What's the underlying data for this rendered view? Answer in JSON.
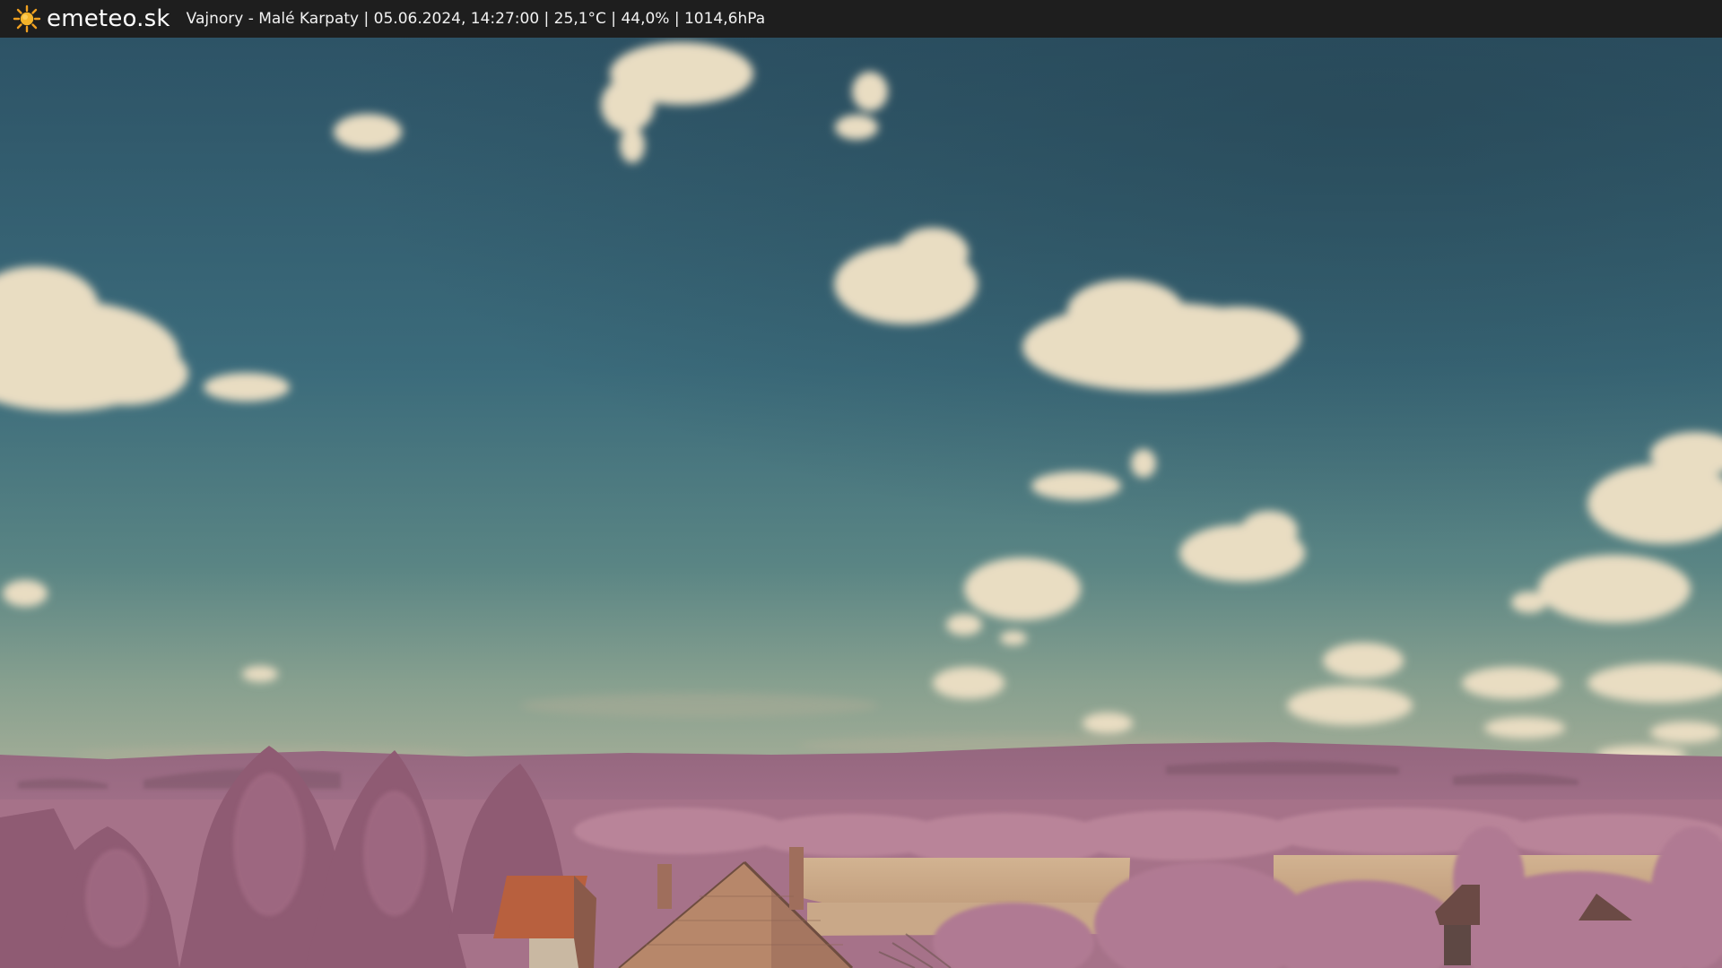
{
  "header": {
    "brand": "emeteo.sk",
    "caption": "Vajnory - Malé Karpaty | 05.06.2024, 14:27:00 | 25,1°C | 44,0% | 1014,6hPa",
    "logo_icon": "sun-icon"
  },
  "colors": {
    "bar_background": "#1e1e1e",
    "sun": "#f0a020",
    "sky_top": "#2f5567",
    "sky_mid": "#3e6f7d",
    "sky_horizon": "#7e9a8d",
    "cloud": "#e8dcc0",
    "hills": "#9c6a84",
    "foliage": "#b07a93",
    "field": "#cfae8c",
    "roof": "#b8603e"
  }
}
